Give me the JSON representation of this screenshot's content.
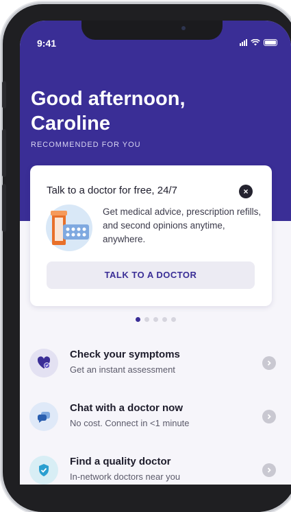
{
  "status_bar": {
    "time": "9:41"
  },
  "header": {
    "greeting_line1": "Good afternoon,",
    "greeting_line2": "Caroline",
    "section_label": "RECOMMENDED FOR YOU"
  },
  "promo_card": {
    "title": "Talk to a doctor for free, 24/7",
    "description": "Get medical advice, prescription refills, and second opinions anytime, anywhere.",
    "cta_label": "TALK TO A DOCTOR",
    "close_symbol": "×"
  },
  "pager": {
    "count": 5,
    "active_index": 0
  },
  "menu": {
    "items": [
      {
        "title": "Check your symptoms",
        "subtitle": "Get an instant assessment",
        "icon": "heart-check-icon"
      },
      {
        "title": "Chat with a doctor now",
        "subtitle": "No cost. Connect in <1 minute",
        "icon": "chat-bubbles-icon"
      },
      {
        "title": "Find a quality doctor",
        "subtitle": "In-network doctors near you",
        "icon": "shield-check-icon"
      }
    ]
  },
  "colors": {
    "brand": "#3a2e96",
    "background": "#f6f5fa",
    "icon_bg": "#dfe9f8"
  }
}
